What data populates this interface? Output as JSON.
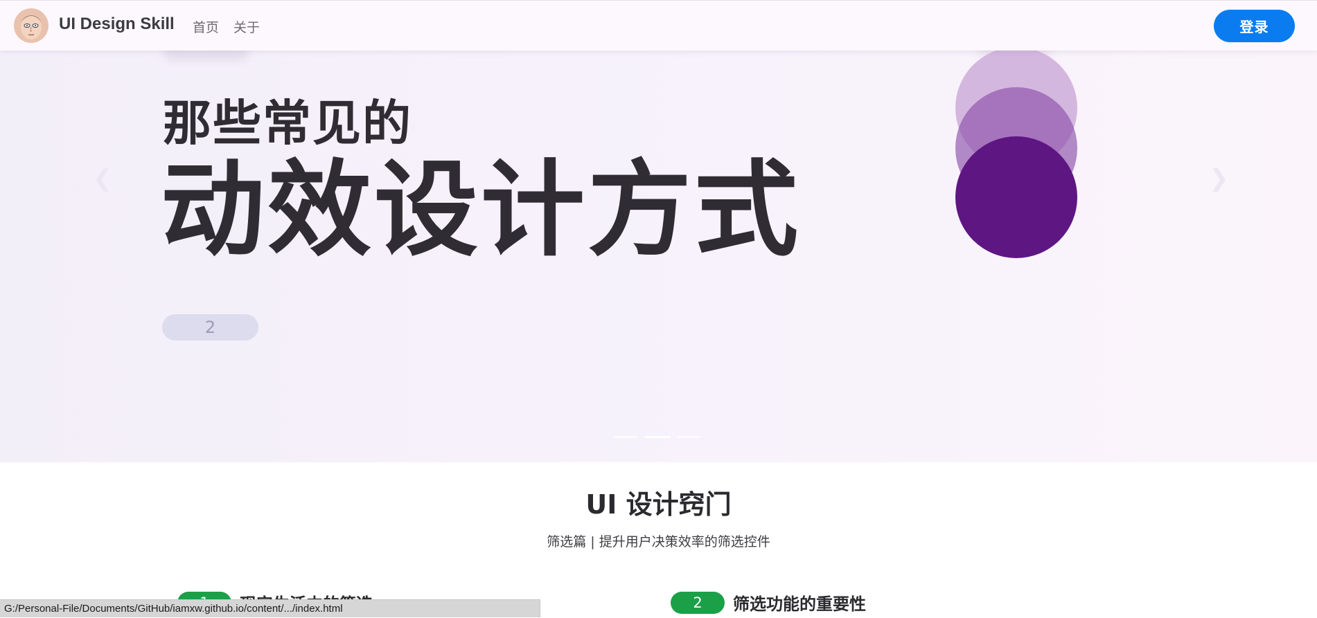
{
  "header": {
    "brand": "UI Design Skill",
    "nav": [
      {
        "label": "首页"
      },
      {
        "label": "关于"
      }
    ],
    "login_label": "登录"
  },
  "hero": {
    "subtitle": "那些常见的",
    "title": "动效设计方式",
    "badge": "2",
    "prev_icon": "chevron-left-icon",
    "next_icon": "chevron-right-icon",
    "slide_count": 3,
    "active_slide": 2,
    "colors": {
      "circle_light": "#d4b7de",
      "circle_mid": "#9a5cb4",
      "circle_dark": "#5e1683"
    }
  },
  "section": {
    "title": "UI 设计窍门",
    "subtitle": "筛选篇 | 提升用户决策效率的筛选控件",
    "items": [
      {
        "number": "1",
        "title": "现实生活中的筛选"
      },
      {
        "number": "2",
        "title": "筛选功能的重要性"
      }
    ]
  },
  "statusbar": {
    "text": "G:/Personal-File/Documents/GitHub/iamxw.github.io/content/.../index.html"
  },
  "colors": {
    "accent": "#0a7cf0",
    "badge_green": "#1ba048"
  }
}
